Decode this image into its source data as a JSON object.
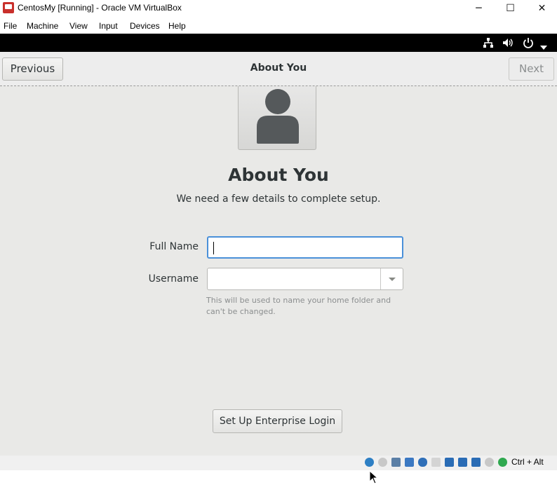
{
  "window": {
    "title": "CentosMy [Running] - Oracle VM VirtualBox",
    "minimize_glyph": "─",
    "maximize_glyph": "☐",
    "close_glyph": "✕"
  },
  "menubar": {
    "items": [
      "File",
      "Machine",
      "View",
      "Input",
      "Devices",
      "Help"
    ]
  },
  "topbar": {
    "icons": [
      "network-icon",
      "volume-icon",
      "power-icon",
      "chevron-down-icon"
    ]
  },
  "header": {
    "previous_label": "Previous",
    "title": "About You",
    "next_label": "Next"
  },
  "main": {
    "heading": "About You",
    "subtitle": "We need a few details to complete setup.",
    "full_name": {
      "label": "Full Name",
      "value": ""
    },
    "username": {
      "label": "Username",
      "value": ""
    },
    "hint": "This will be used to name your home folder and can't be changed.",
    "enterprise_button": "Set Up Enterprise Login"
  },
  "statusbar": {
    "hostkey": "Ctrl + Alt",
    "icons": [
      "hard-disk-icon",
      "optical-drive-icon",
      "audio-icon",
      "network-adapter-icon",
      "usb-icon",
      "shared-folders-icon",
      "display-icon",
      "video-capture-icon",
      "recording-icon",
      "virtualization-icon",
      "mouse-integration-icon",
      "keyboard-capture-icon"
    ]
  },
  "colors": {
    "accent": "#4a90d9",
    "background": "#e9e9e7",
    "text": "#2e3436",
    "hint_text": "#8b8e8f"
  }
}
